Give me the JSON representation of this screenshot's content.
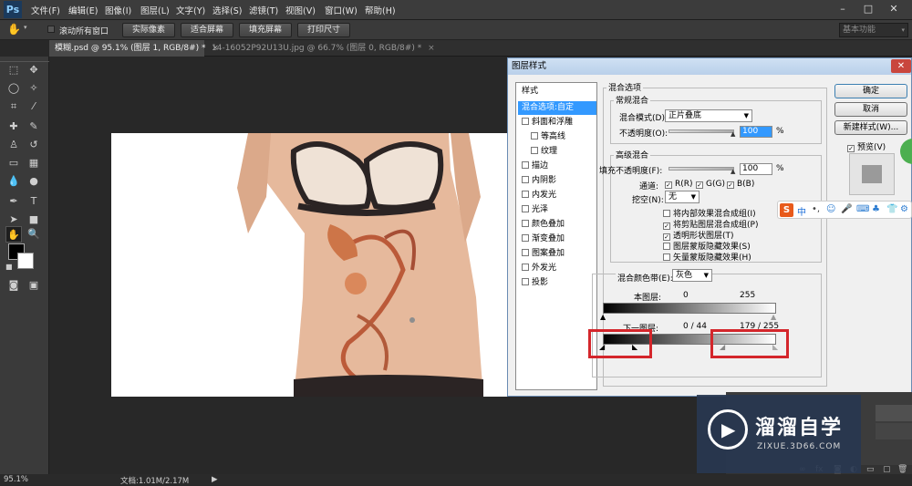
{
  "menubar": {
    "logo": "Ps",
    "items": [
      "文件(F)",
      "编辑(E)",
      "图像(I)",
      "图层(L)",
      "文字(Y)",
      "选择(S)",
      "滤镜(T)",
      "视图(V)",
      "窗口(W)",
      "帮助(H)"
    ],
    "window_controls": [
      "–",
      "□",
      "✕"
    ]
  },
  "options": {
    "scroll_all": "滚动所有窗口",
    "buttons": [
      "实际像素",
      "适合屏幕",
      "填充屏幕",
      "打印尺寸"
    ],
    "workspace": "基本功能"
  },
  "tabs": [
    {
      "label": "模糊.psd @ 95.1% (图层 1, RGB/8#) *",
      "close": "×"
    },
    {
      "label": "14-16052P92U13U.jpg @ 66.7% (图层 0, RGB/8#) *",
      "close": "×"
    }
  ],
  "status": {
    "zoom": "95.1%",
    "doc": "文档:1.01M/2.17M"
  },
  "dialog": {
    "title": "图层样式",
    "close": "✕",
    "styles_header": "样式",
    "styles": [
      {
        "label": "混合选项:自定",
        "selected": true,
        "checkbox": false
      },
      {
        "label": "斜面和浮雕",
        "checkbox": true
      },
      {
        "label": "等高线",
        "checkbox": true,
        "indent": true
      },
      {
        "label": "纹理",
        "checkbox": true,
        "indent": true
      },
      {
        "label": "描边",
        "checkbox": true
      },
      {
        "label": "内阴影",
        "checkbox": true
      },
      {
        "label": "内发光",
        "checkbox": true
      },
      {
        "label": "光泽",
        "checkbox": true
      },
      {
        "label": "颜色叠加",
        "checkbox": true
      },
      {
        "label": "渐变叠加",
        "checkbox": true
      },
      {
        "label": "图案叠加",
        "checkbox": true
      },
      {
        "label": "外发光",
        "checkbox": true
      },
      {
        "label": "投影",
        "checkbox": true
      }
    ],
    "blend_options_title": "混合选项",
    "general_title": "常规混合",
    "blend_mode_label": "混合模式(D):",
    "blend_mode_value": "正片叠底",
    "opacity_label": "不透明度(O):",
    "opacity_value": "100",
    "percent": "%",
    "advanced_title": "高级混合",
    "fill_opacity_label": "填充不透明度(F):",
    "fill_opacity_value": "100",
    "channels_label": "通道:",
    "channels": [
      "R(R)",
      "G(G)",
      "B(B)"
    ],
    "knockout_label": "挖空(N):",
    "knockout_value": "无",
    "options": [
      {
        "label": "将内部效果混合成组(I)",
        "checked": false
      },
      {
        "label": "将剪贴图层混合成组(P)",
        "checked": true
      },
      {
        "label": "透明形状图层(T)",
        "checked": true
      },
      {
        "label": "图层蒙版隐藏效果(S)",
        "checked": false
      },
      {
        "label": "矢量蒙版隐藏效果(H)",
        "checked": false
      }
    ],
    "blend_if_label": "混合颜色带(E):",
    "blend_if_value": "灰色",
    "this_layer_label": "本图层:",
    "this_layer_black": "0",
    "this_layer_white": "255",
    "underlying_label": "下一图层:",
    "underlying_values": "0 / 44",
    "underlying_values_right": "179 / 255",
    "buttons": {
      "ok": "确定",
      "cancel": "取消",
      "new_style": "新建样式(W)...",
      "preview": "预览(V)"
    }
  },
  "ime": {
    "logo": "S",
    "lang": "中"
  },
  "watermark": {
    "title": "溜溜自学",
    "url": "ZIXUE.3D66.COM"
  },
  "colors": {
    "accent": "#3399ff",
    "highlight": "#d4262b",
    "photoshop_bg": "#282828"
  }
}
